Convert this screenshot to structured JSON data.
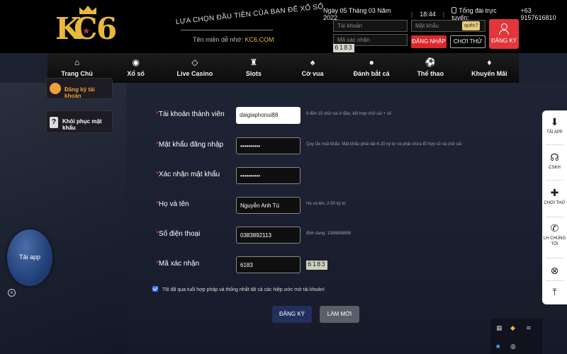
{
  "header": {
    "logo_text": "KC6",
    "slogan": "LỰA CHỌN ĐẦU TIÊN CỦA BẠN ĐỂ XỔ SỐ",
    "domain_label": "Tên miền dễ nhớ:",
    "domain_value": "KC6.COM",
    "date": "Ngày 05 Tháng 03 Năm 2022",
    "time": "18:44",
    "hotline_label": "Tổng đài trực tuyến:",
    "hotline_number": "+63 9157616810"
  },
  "login": {
    "account_placeholder": "Tài khoản",
    "password_placeholder": "Mật khẩu",
    "forgot_label": "quên?",
    "captcha_placeholder": "Mã xác nhận",
    "captcha_code": "6183",
    "login_button": "ĐĂNG NHẬP",
    "try_button": "CHƠI THỬ",
    "register_button": "ĐĂNG KÝ"
  },
  "nav": [
    {
      "label": "Trang Chủ",
      "icon": "home-icon"
    },
    {
      "label": "Xổ số",
      "icon": "lottery-icon"
    },
    {
      "label": "Live Casino",
      "icon": "diamond-icon"
    },
    {
      "label": "Slots",
      "icon": "slots-icon"
    },
    {
      "label": "Cờ vua",
      "icon": "cards-icon"
    },
    {
      "label": "Đánh bắt cá",
      "icon": "fish-icon"
    },
    {
      "label": "Thể thao",
      "icon": "soccer-ball-icon"
    },
    {
      "label": "Khuyến Mãi",
      "icon": "gift-icon"
    }
  ],
  "sidebar": {
    "register_account": "Đăng ký tài khoản",
    "recover_password": "Khôi phục mật khẩu"
  },
  "form": {
    "account": {
      "label": "Tài khoản thành viên",
      "value": "daigiaphonui88",
      "hint": "6 đến 15 chữ cái ở đầu, kết hợp chữ cái + số"
    },
    "password": {
      "label": "Mật khẩu đăng nhập",
      "value": "••••••••••",
      "hint": "Quy tắc mật khẩu: Mật khẩu phải dài 6-20 ký tự và phải chứa tổ hợp số và chữ cái"
    },
    "confirm": {
      "label": "Xác nhận mật khẩu",
      "value": "••••••••••"
    },
    "fullname": {
      "label": "Họ và tên",
      "value": "Nguyễn Anh Tú",
      "hint": "Họ và tên, 2-50 ký tự"
    },
    "phone": {
      "label": "Số điện thoại",
      "value": "0383892113",
      "hint": "định dạng: 1388888888"
    },
    "captcha": {
      "label": "Mã xác nhận",
      "value": "6183",
      "code": "6183"
    },
    "agree_text": "Tôi đã qua tuổi hợp pháp và thống nhất tất cả các hiệp ước mở tài khoản!",
    "submit_label": "ĐĂNG KÝ",
    "reset_label": "LÀM MỚI",
    "required_mark": "*"
  },
  "floating": {
    "tai_app": "Tải app",
    "close": "×"
  },
  "rail": [
    {
      "label": "TẢI APP",
      "icon": "download-icon"
    },
    {
      "label": "CSKH",
      "icon": "headset-icon"
    },
    {
      "label": "CHƠI THỬ",
      "icon": "gamepad-icon"
    },
    {
      "label": "LH CHÚNG TÔI",
      "icon": "phone-call-icon"
    },
    {
      "label": "",
      "icon": "close-icon"
    },
    {
      "label": "",
      "icon": "back-to-top-icon"
    }
  ],
  "colors": {
    "accent_red": "#e2363b",
    "gold": "#e8b93a",
    "submit_blue": "#23305e"
  }
}
